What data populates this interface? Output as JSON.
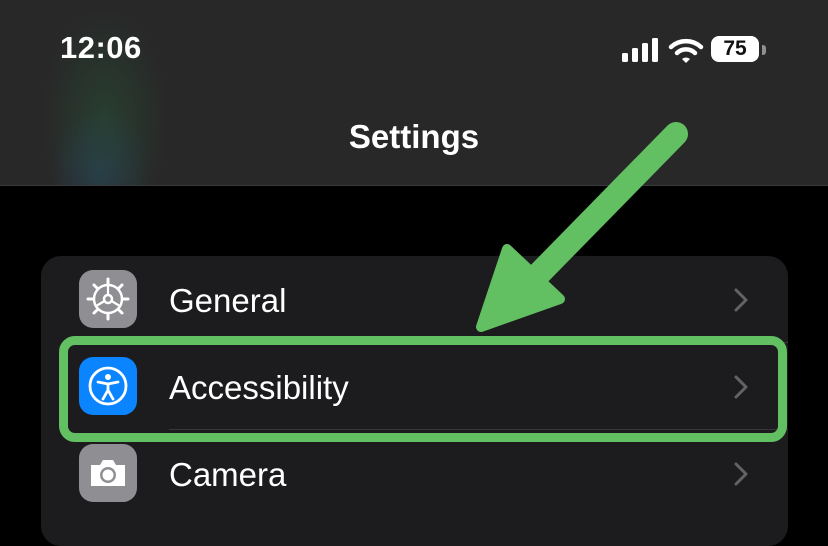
{
  "status_bar": {
    "time": "12:06",
    "battery_level": "75",
    "icons": [
      "signal-icon",
      "wifi-icon",
      "battery-icon"
    ]
  },
  "nav": {
    "title": "Settings"
  },
  "settings_rows": [
    {
      "label": "General",
      "icon": "gear-icon",
      "icon_color": "#8e8e93"
    },
    {
      "label": "Accessibility",
      "icon": "accessibility-icon",
      "icon_color": "#0a84ff"
    },
    {
      "label": "Camera",
      "icon": "camera-icon",
      "icon_color": "#8e8e93"
    }
  ],
  "annotation": {
    "highlight_color": "#62c062",
    "highlighted_row": "Accessibility"
  }
}
